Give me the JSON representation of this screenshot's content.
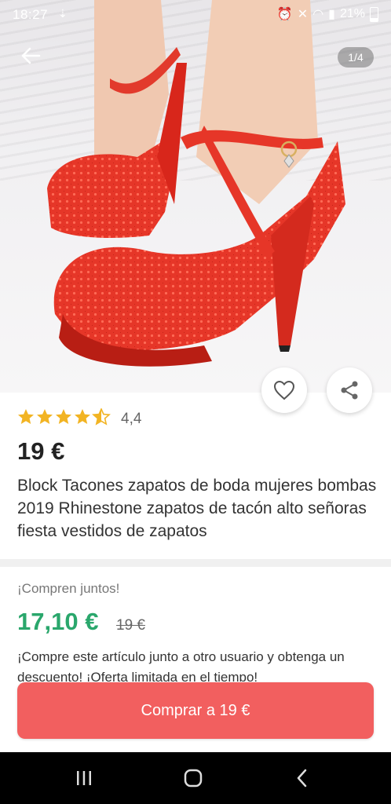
{
  "status_bar": {
    "time": "18:27",
    "battery": "21%"
  },
  "gallery": {
    "counter": "1/4"
  },
  "product": {
    "rating_stars": 4.4,
    "rating": "4,4",
    "price": "19 €",
    "title": "Block Tacones zapatos de boda mujeres bombas 2019 Rhinestone zapatos de tacón alto señoras fiesta vestidos de zapatos"
  },
  "group_buy": {
    "label": "¡Compren juntos!",
    "price": "17,10 €",
    "old_price": "19 €",
    "description": "¡Compre este artículo junto a otro usuario y obtenga un descuento! ¡Oferta limitada en el tiempo!"
  },
  "cta": {
    "label": "Comprar a 19 €"
  },
  "colors": {
    "accent": "#f25f5f",
    "group_price": "#2aa76c",
    "star": "#f2b423"
  },
  "icons": [
    "back-arrow-icon",
    "heart-icon",
    "share-icon",
    "recents-icon",
    "home-icon",
    "back-nav-icon"
  ]
}
